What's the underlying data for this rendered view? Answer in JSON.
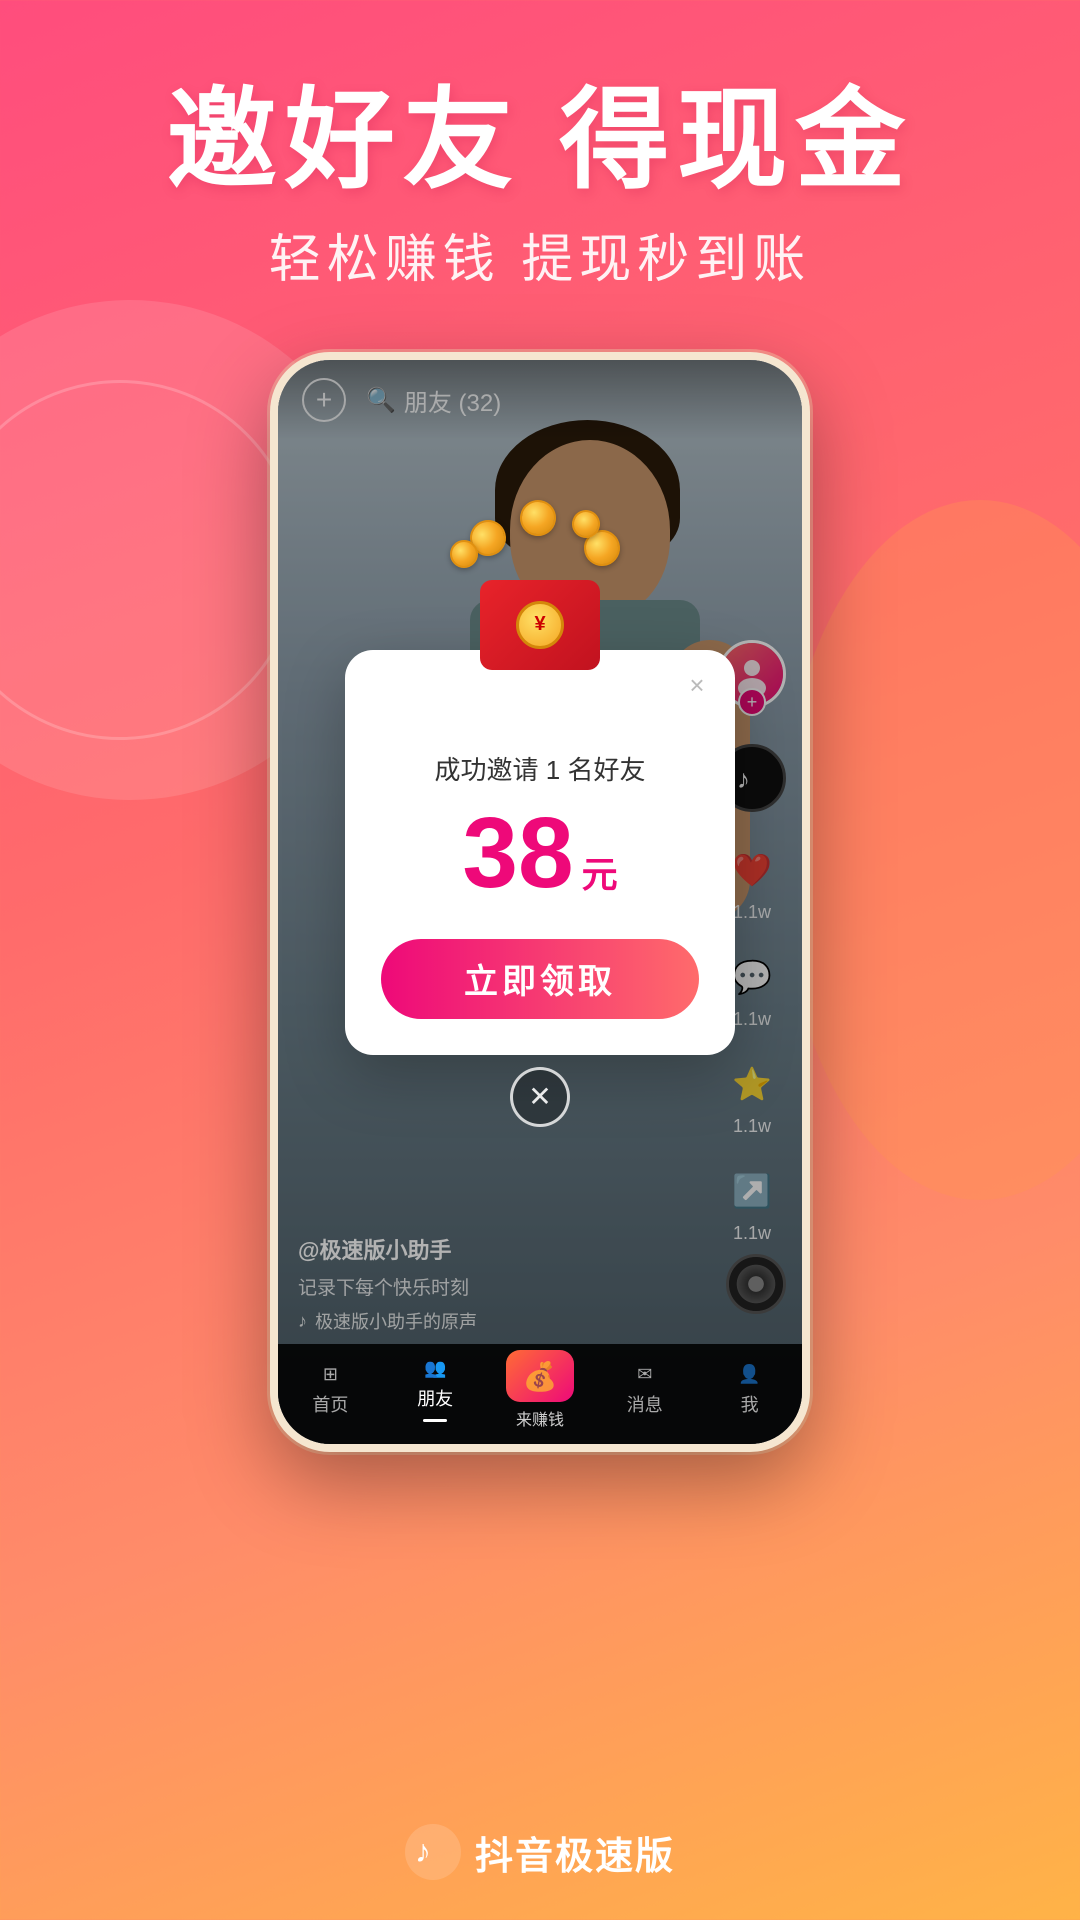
{
  "background": {
    "gradient_start": "#ff4d7d",
    "gradient_end": "#ffb347"
  },
  "header": {
    "main_title": "邀好友 得现金",
    "sub_title": "轻松赚钱 提现秒到账"
  },
  "phone": {
    "top_bar": {
      "add_icon": "+",
      "search_label": "朋友 (32)"
    },
    "video": {
      "username": "@极速版小助手",
      "description": "记录下每个快乐时刻",
      "music": "极速版小助手的原声"
    },
    "sidebar": {
      "like_count": "1.1w",
      "comment_count": "1.1w",
      "favorite_count": "1.1w",
      "share_count": "1.1w"
    },
    "bottom_nav": {
      "items": [
        {
          "label": "首页",
          "active": false
        },
        {
          "label": "朋友",
          "active": true
        },
        {
          "label": "来赚钱",
          "active": false,
          "center": true
        },
        {
          "label": "消息",
          "active": false
        },
        {
          "label": "我",
          "active": false
        }
      ]
    },
    "popup": {
      "invite_text": "成功邀请 1 名好友",
      "amount_number": "38",
      "amount_unit": "元",
      "claim_button_label": "立即领取",
      "close_icon": "×"
    }
  },
  "branding": {
    "app_name": "抖音极速版",
    "logo_icon": "♪"
  }
}
